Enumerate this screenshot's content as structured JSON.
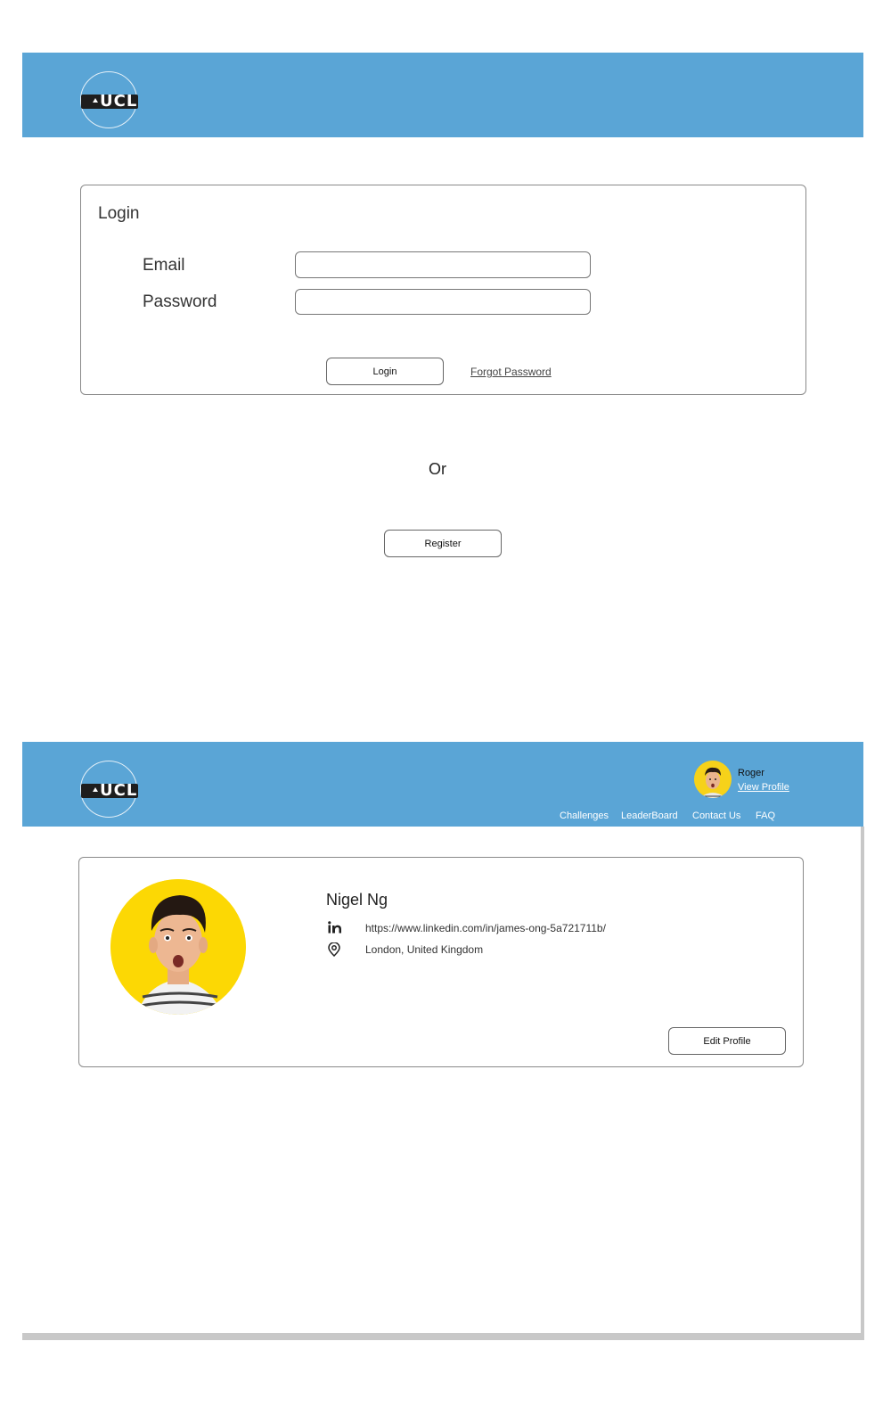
{
  "login_screen": {
    "card_title": "Login",
    "email_label": "Email",
    "email_value": "",
    "password_label": "Password",
    "password_value": "",
    "login_button": "Login",
    "forgot_password_link": "Forgot Password",
    "or_text": "Or",
    "register_button": "Register"
  },
  "logo": {
    "text": "UCL"
  },
  "profile_screen": {
    "user_menu": {
      "name": "Roger",
      "view_profile_link": "View Profile"
    },
    "nav": [
      {
        "label": "Challenges"
      },
      {
        "label": "LeaderBoard"
      },
      {
        "label": "Contact Us"
      },
      {
        "label": "FAQ"
      }
    ],
    "profile": {
      "name": "Nigel Ng",
      "linkedin_url": "https://www.linkedin.com/in/james-ong-5a721711b/",
      "location": "London, United Kingdom",
      "edit_button": "Edit Profile"
    }
  },
  "colors": {
    "header_blue": "#5aa5d6",
    "avatar_yellow": "#fcd804"
  },
  "icons": [
    "linkedin-icon",
    "location-pin-icon"
  ]
}
